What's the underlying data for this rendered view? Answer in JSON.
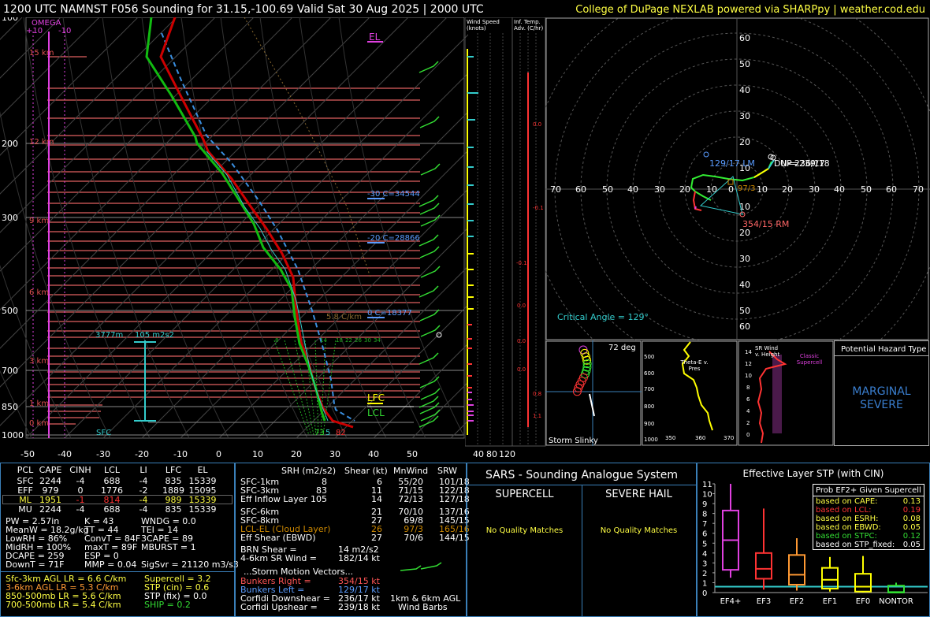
{
  "header": {
    "title": "1200 UTC NAMNST F056 Sounding for 31.15,-100.69 Valid  Sat 30 Aug 2025 | 2000 UTC",
    "credit": "College of DuPage NEXLAB powered via SHARPpy | weather.cod.edu"
  },
  "skewt": {
    "omega_label": "OMEGA",
    "omega_ticks": [
      "+10",
      "0",
      "-10"
    ],
    "pressure_labels": [
      "100",
      "200",
      "300",
      "500",
      "700",
      "850",
      "1000"
    ],
    "temp_labels": [
      "-50",
      "-40",
      "-30",
      "-20",
      "-10",
      "0",
      "10",
      "20",
      "30",
      "40",
      "50"
    ],
    "height_labels": [
      "15 km",
      "12 km",
      "9 km",
      "6 km",
      "3 km",
      "1 km",
      "0 km"
    ],
    "el_label": "EL",
    "lfc_label": "LFC",
    "lcl_label": "LCL",
    "sfc_label": "SFC",
    "iso30_label": "-30 C=34544",
    "iso20_label": "-20 C=28866",
    "iso0_label": "0 C=18377",
    "lapse_label": "5.8 C/km",
    "eff_layer_label": "3777m",
    "eff_srh_label": "105 m2s2",
    "sfc_temp": "82",
    "sfc_dew": "73",
    "sfc_wetbulb": "5",
    "wb_labels": [
      "8",
      "14",
      "18",
      "22",
      "26",
      "30",
      "34"
    ]
  },
  "wind_speed": {
    "title": "Wind Speed (knots)",
    "ticks": [
      "40",
      "80",
      "120"
    ]
  },
  "inf_temp": {
    "title": "Inf. Temp. Adv. (C/hr)",
    "values": [
      "0.0",
      "-0.1",
      "-0.1",
      "0.0",
      "0.0",
      "0.0",
      "0.8",
      "1.1"
    ]
  },
  "hodograph": {
    "ring_labels": [
      "60",
      "50",
      "40",
      "30",
      "20",
      "10"
    ],
    "x_labels": [
      "70",
      "60",
      "50",
      "40",
      "30",
      "20",
      "10",
      "0",
      "10",
      "20",
      "30",
      "40",
      "50",
      "60",
      "70"
    ],
    "lm_label": "129/17 LM",
    "rm_label": "354/15 RM",
    "mean_label": "97/3",
    "dn_label": "DN=236/17",
    "up_label": "UP=239/18",
    "critical_angle": "Critical Angle = 129°"
  },
  "slinky": {
    "label": "Storm Slinky",
    "deg": "72 deg"
  },
  "theta": {
    "label": "Theta-E v. Pres",
    "pres": [
      "500",
      "600",
      "700",
      "800",
      "900",
      "1000"
    ],
    "x": [
      "350",
      "360",
      "370"
    ]
  },
  "srwind": {
    "label": "SR Wind v. Height",
    "classic": "Classic Supercell",
    "y": [
      "14",
      "12",
      "10",
      "8",
      "6",
      "4",
      "2",
      "0"
    ]
  },
  "hazard": {
    "title": "Potential Hazard Type",
    "value1": "MARGINAL",
    "value2": "SEVERE"
  },
  "parcels": {
    "headers": [
      "PCL",
      "CAPE",
      "CINH",
      "LCL",
      "LI",
      "LFC",
      "EL"
    ],
    "rows": [
      [
        "SFC",
        "2244",
        "-4",
        "688",
        "-4",
        "835",
        "15339"
      ],
      [
        "EFF",
        "979",
        "0",
        "1776",
        "-2",
        "1889",
        "15095"
      ],
      [
        "ML",
        "1951",
        "-1",
        "814",
        "-4",
        "989",
        "15339"
      ],
      [
        "MU",
        "2244",
        "-4",
        "688",
        "-4",
        "835",
        "15339"
      ]
    ]
  },
  "thermo": [
    [
      "PW = 2.57in",
      "K = 43",
      "WNDG = 0.0"
    ],
    [
      "MeanW = 18.2g/kg",
      "TT = 44",
      "TEI = 14"
    ],
    [
      "LowRH = 86%",
      "ConvT = 84F",
      "3CAPE = 89"
    ],
    [
      "MidRH = 100%",
      "maxT = 89F",
      "MBURST = 1"
    ],
    [
      "DCAPE = 259",
      "ESP = 0",
      ""
    ],
    [
      "DownT = 71F",
      "MMP = 0.04",
      "SigSvr = 21120 m3/s3"
    ]
  ],
  "lapse": [
    "Sfc-3km AGL LR = 6.6 C/km",
    "3-6km AGL LR = 5.3 C/km",
    "850-500mb LR = 5.6 C/km",
    "700-500mb LR = 5.4 C/km"
  ],
  "indices": [
    "Supercell = 3.2",
    "STP (cin) = 0.6",
    "STP (fix) = 0.0",
    "SHIP = 0.2"
  ],
  "kinematic": {
    "headers": [
      "SRH (m2/s2)",
      "Shear (kt)",
      "MnWind",
      "SRW"
    ],
    "rows1": [
      [
        "SFC-1km",
        "8",
        "6",
        "55/20",
        "101/18"
      ],
      [
        "SFC-3km",
        "83",
        "11",
        "71/15",
        "122/18"
      ],
      [
        "Eff Inflow Layer",
        "105",
        "14",
        "72/13",
        "127/18"
      ]
    ],
    "rows2": [
      [
        "SFC-6km",
        "",
        "21",
        "70/10",
        "137/16"
      ],
      [
        "SFC-8km",
        "",
        "27",
        "69/8",
        "145/15"
      ],
      [
        "LCL-EL (Cloud Layer)",
        "",
        "26",
        "97/3",
        "165/16"
      ],
      [
        "Eff Shear (EBWD)",
        "",
        "27",
        "70/6",
        "144/15"
      ]
    ],
    "brn_label": "BRN Shear =",
    "brn_value": "14 m2/s2",
    "sr46_label": "4-6km SR Wind =",
    "sr46_value": "182/14 kt",
    "storm_motion_title": "...Storm Motion Vectors...",
    "motions": [
      [
        "Bunkers Right =",
        "354/15 kt"
      ],
      [
        "Bunkers Left =",
        "129/17 kt"
      ],
      [
        "Corfidi Downshear =",
        "236/17 kt"
      ],
      [
        "Corfidi Upshear =",
        "239/18 kt"
      ]
    ],
    "barb_caption1": "1km & 6km AGL",
    "barb_caption2": "Wind Barbs"
  },
  "sars": {
    "title": "SARS - Sounding Analogue System",
    "supercell": "SUPERCELL",
    "hail": "SEVERE HAIL",
    "no_match1": "No Quality Matches",
    "no_match2": "No Quality Matches"
  },
  "stp": {
    "title": "Effective Layer STP (with CIN)",
    "y_labels": [
      "11",
      "10",
      "9",
      "8",
      "7",
      "6",
      "5",
      "4",
      "3",
      "2",
      "1",
      "0"
    ],
    "categories": [
      "EF4+",
      "EF3",
      "EF2",
      "EF1",
      "EF0",
      "NONTOR"
    ],
    "legend_title": "Prob EF2+ Given Supercell",
    "legend": [
      [
        "based on CAPE:",
        "0.13"
      ],
      [
        "based on LCL:",
        "0.19"
      ],
      [
        "based on ESRH:",
        "0.08"
      ],
      [
        "based on EBWD:",
        "0.05"
      ],
      [
        "based on STPC:",
        "0.12"
      ],
      [
        "based on STP_fixed:",
        "0.05"
      ]
    ]
  },
  "chart_data": {
    "type": "box",
    "title": "Effective Layer STP (with CIN)",
    "categories": [
      "EF4+",
      "EF3",
      "EF2",
      "EF1",
      "EF0",
      "NONTOR"
    ],
    "ylim": [
      0,
      11
    ],
    "boxes": [
      {
        "low": 1.5,
        "q1": 2.3,
        "median": 5.3,
        "q3": 8.3,
        "high": 11
      },
      {
        "low": 0.3,
        "q1": 1.4,
        "median": 2.4,
        "q3": 4.0,
        "high": 8.5
      },
      {
        "low": 0.2,
        "q1": 0.8,
        "median": 1.8,
        "q3": 3.8,
        "high": 5.5
      },
      {
        "low": 0.1,
        "q1": 0.4,
        "median": 1.3,
        "q3": 2.5,
        "high": 3.6
      },
      {
        "low": 0.0,
        "q1": 0.1,
        "median": 0.6,
        "q3": 1.9,
        "high": 3.7
      },
      {
        "low": 0.0,
        "q1": 0.0,
        "median": 0.05,
        "q3": 0.7,
        "high": 1.0
      }
    ],
    "reference_line": 0.6
  }
}
